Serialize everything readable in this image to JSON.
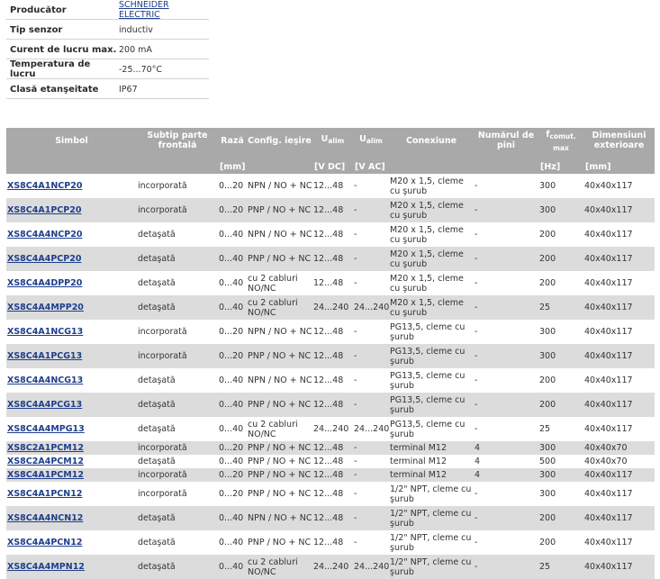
{
  "specs": [
    {
      "label": "Producător",
      "value": "SCHNEIDER ELECTRIC",
      "link": true
    },
    {
      "label": "Tip senzor",
      "value": "inductiv",
      "link": false
    },
    {
      "label": "Curent de lucru max.",
      "value": "200 mA",
      "link": false
    },
    {
      "label": "Temperatura de lucru",
      "value": "-25...70°C",
      "link": false
    },
    {
      "label": "Clasă etanşeitate",
      "value": "IP67",
      "link": false
    }
  ],
  "table": {
    "headers": {
      "simbol": "Simbol",
      "subtip": "Subtip parte frontală",
      "raza": "Rază",
      "config": "Config. ieşire",
      "ualim": "U",
      "ualim_sub": "alim",
      "conexiune": "Conexiune",
      "pini": "Numărul de pini",
      "fcomut": "f",
      "fcomut_sub": "comut. max",
      "dimensiuni": "Dimensiuni exterioare"
    },
    "units": {
      "raza": "[mm]",
      "udc": "[V DC]",
      "uac": "[V AC]",
      "freq": "[Hz]",
      "dim": "[mm]"
    },
    "rows": [
      {
        "symbol": "XS8C4A1NCP20",
        "front": "incorporată",
        "range": "0...20",
        "output": "NPN / NO + NC",
        "vdc": "12...48",
        "vac": "-",
        "connection": "M20 x 1,5, cleme cu şurub",
        "pins": "-",
        "freq": "300",
        "dims": "40x40x117",
        "tall": true
      },
      {
        "symbol": "XS8C4A1PCP20",
        "front": "incorporată",
        "range": "0...20",
        "output": "PNP / NO + NC",
        "vdc": "12...48",
        "vac": "-",
        "connection": "M20 x 1,5, cleme cu şurub",
        "pins": "-",
        "freq": "300",
        "dims": "40x40x117",
        "tall": true
      },
      {
        "symbol": "XS8C4A4NCP20",
        "front": "detaşată",
        "range": "0...40",
        "output": "NPN / NO + NC",
        "vdc": "12...48",
        "vac": "-",
        "connection": "M20 x 1,5, cleme cu şurub",
        "pins": "-",
        "freq": "200",
        "dims": "40x40x117",
        "tall": true
      },
      {
        "symbol": "XS8C4A4PCP20",
        "front": "detaşată",
        "range": "0...40",
        "output": "PNP / NO + NC",
        "vdc": "12...48",
        "vac": "-",
        "connection": "M20 x 1,5, cleme cu şurub",
        "pins": "-",
        "freq": "200",
        "dims": "40x40x117",
        "tall": true
      },
      {
        "symbol": "XS8C4A4DPP20",
        "front": "detaşată",
        "range": "0...40",
        "output": "cu 2 cabluri NO/NC",
        "vdc": "12...48",
        "vac": "-",
        "connection": "M20 x 1,5, cleme cu şurub",
        "pins": "-",
        "freq": "200",
        "dims": "40x40x117",
        "tall": true
      },
      {
        "symbol": "XS8C4A4MPP20",
        "front": "detaşată",
        "range": "0...40",
        "output": "cu 2 cabluri NO/NC",
        "vdc": "24...240",
        "vac": "24...240",
        "connection": "M20 x 1,5, cleme cu şurub",
        "pins": "-",
        "freq": "25",
        "dims": "40x40x117",
        "tall": true
      },
      {
        "symbol": "XS8C4A1NCG13",
        "front": "incorporată",
        "range": "0...20",
        "output": "NPN / NO + NC",
        "vdc": "12...48",
        "vac": "-",
        "connection": "PG13,5, cleme cu şurub",
        "pins": "-",
        "freq": "300",
        "dims": "40x40x117",
        "tall": true
      },
      {
        "symbol": "XS8C4A1PCG13",
        "front": "incorporată",
        "range": "0...20",
        "output": "PNP / NO + NC",
        "vdc": "12...48",
        "vac": "-",
        "connection": "PG13,5, cleme cu şurub",
        "pins": "-",
        "freq": "300",
        "dims": "40x40x117",
        "tall": true
      },
      {
        "symbol": "XS8C4A4NCG13",
        "front": "detaşată",
        "range": "0...40",
        "output": "NPN / NO + NC",
        "vdc": "12...48",
        "vac": "-",
        "connection": "PG13,5, cleme cu şurub",
        "pins": "-",
        "freq": "200",
        "dims": "40x40x117",
        "tall": true
      },
      {
        "symbol": "XS8C4A4PCG13",
        "front": "detaşată",
        "range": "0...40",
        "output": "PNP / NO + NC",
        "vdc": "12...48",
        "vac": "-",
        "connection": "PG13,5, cleme cu şurub",
        "pins": "-",
        "freq": "200",
        "dims": "40x40x117",
        "tall": true
      },
      {
        "symbol": "XS8C4A4MPG13",
        "front": "detaşată",
        "range": "0...40",
        "output": "cu 2 cabluri NO/NC",
        "vdc": "24...240",
        "vac": "24...240",
        "connection": "PG13,5, cleme cu şurub",
        "pins": "-",
        "freq": "25",
        "dims": "40x40x117",
        "tall": true
      },
      {
        "symbol": "XS8C2A1PCM12",
        "front": "incorporată",
        "range": "0...20",
        "output": "PNP / NO + NC",
        "vdc": "12...48",
        "vac": "-",
        "connection": "terminal M12",
        "pins": "4",
        "freq": "300",
        "dims": "40x40x70",
        "tall": false
      },
      {
        "symbol": "XS8C2A4PCM12",
        "front": "detaşată",
        "range": "0...40",
        "output": "PNP / NO + NC",
        "vdc": "12...48",
        "vac": "-",
        "connection": "terminal M12",
        "pins": "4",
        "freq": "500",
        "dims": "40x40x70",
        "tall": false
      },
      {
        "symbol": "XS8C4A1PCM12",
        "front": "incorporată",
        "range": "0...20",
        "output": "PNP / NO + NC",
        "vdc": "12...48",
        "vac": "-",
        "connection": "terminal M12",
        "pins": "4",
        "freq": "300",
        "dims": "40x40x117",
        "tall": false
      },
      {
        "symbol": "XS8C4A1PCN12",
        "front": "incorporată",
        "range": "0...20",
        "output": "PNP / NO + NC",
        "vdc": "12...48",
        "vac": "-",
        "connection": "1/2\" NPT, cleme cu şurub",
        "pins": "-",
        "freq": "300",
        "dims": "40x40x117",
        "tall": true
      },
      {
        "symbol": "XS8C4A4NCN12",
        "front": "detaşată",
        "range": "0...40",
        "output": "NPN / NO + NC",
        "vdc": "12...48",
        "vac": "-",
        "connection": "1/2\" NPT, cleme cu şurub",
        "pins": "-",
        "freq": "200",
        "dims": "40x40x117",
        "tall": true
      },
      {
        "symbol": "XS8C4A4PCN12",
        "front": "detaşată",
        "range": "0...40",
        "output": "PNP / NO + NC",
        "vdc": "12...48",
        "vac": "-",
        "connection": "1/2\" NPT, cleme cu şurub",
        "pins": "-",
        "freq": "200",
        "dims": "40x40x117",
        "tall": true
      },
      {
        "symbol": "XS8C4A4MPN12",
        "front": "detaşată",
        "range": "0...40",
        "output": "cu 2 cabluri NO/NC",
        "vdc": "24...240",
        "vac": "24...240",
        "connection": "1/2\" NPT, cleme cu şurub",
        "pins": "-",
        "freq": "25",
        "dims": "40x40x117",
        "tall": true
      }
    ]
  },
  "colors": {
    "header_bg": "#a9a9a9",
    "row_alt": "#dcdcdc",
    "link": "#1f3f8c"
  }
}
